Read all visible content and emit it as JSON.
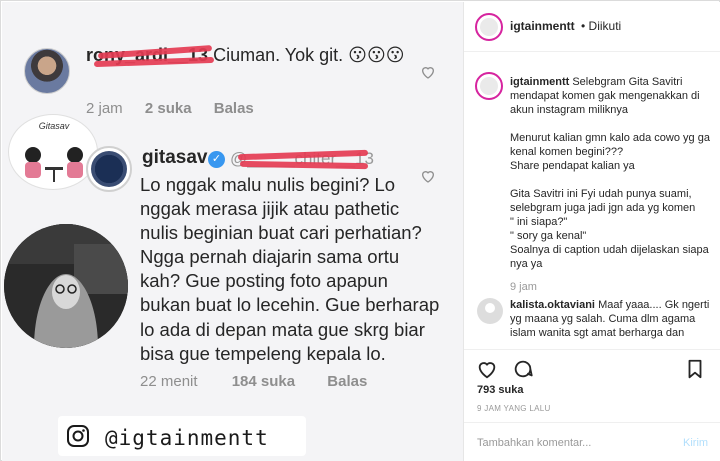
{
  "comment1": {
    "username": "rony_ardi__13",
    "text": "Ciuman. Yok git. 😗😗😗",
    "time": "2 jam",
    "likes": "2 suka",
    "reply": "Balas"
  },
  "sticker": {
    "label": "Gitasav"
  },
  "comment2": {
    "username": "gitasav",
    "mention": "@_____chiter__13",
    "text": "Lo nggak malu nulis begini? Lo nggak merasa jijik atau pathetic nulis beginian buat cari perhatian? Ngga pernah diajarin sama ortu kah? Gue posting foto apapun bukan buat lo lecehin. Gue berharap lo ada di depan mata gue skrg biar bisa gue tempeleng kepala lo.",
    "time": "22 menit",
    "likes": "184 suka",
    "reply": "Balas"
  },
  "watermark": {
    "handle": "@igtainmentt"
  },
  "post": {
    "username": "igtainmentt",
    "follow": "• Diikuti",
    "caption_user": "igtainmentt",
    "caption": "Selebgram Gita Savitri mendapat komen gak mengenakkan di akun instagram miliknya\n\nMenurut kalian gmn kalo ada cowo yg ga kenal komen begini???\nShare pendapat kalian ya\n\nGita Savitri ini Fyi udah punya suami, selebgram juga jadi jgn ada yg komen\n\" ini siapa?\"\n\" sory ga kenal\"\nSoalnya di caption udah dijelaskan siapa nya ya",
    "caption_time": "9 jam",
    "comment_user": "kalista.oktaviani",
    "comment_text": "Maaf yaaa.... Gk ngerti yg maana yg salah. Cuma dlm agama islam wanita sgt amat berharga dan mulia",
    "likes": "793 suka",
    "post_time": "9 JAM YANG LALU",
    "add_comment": "Tambahkan komentar...",
    "send": "Kirim"
  },
  "colors": {
    "scribble": "#e43b52",
    "verified": "#3897f0",
    "muted": "#8e8e8e"
  }
}
